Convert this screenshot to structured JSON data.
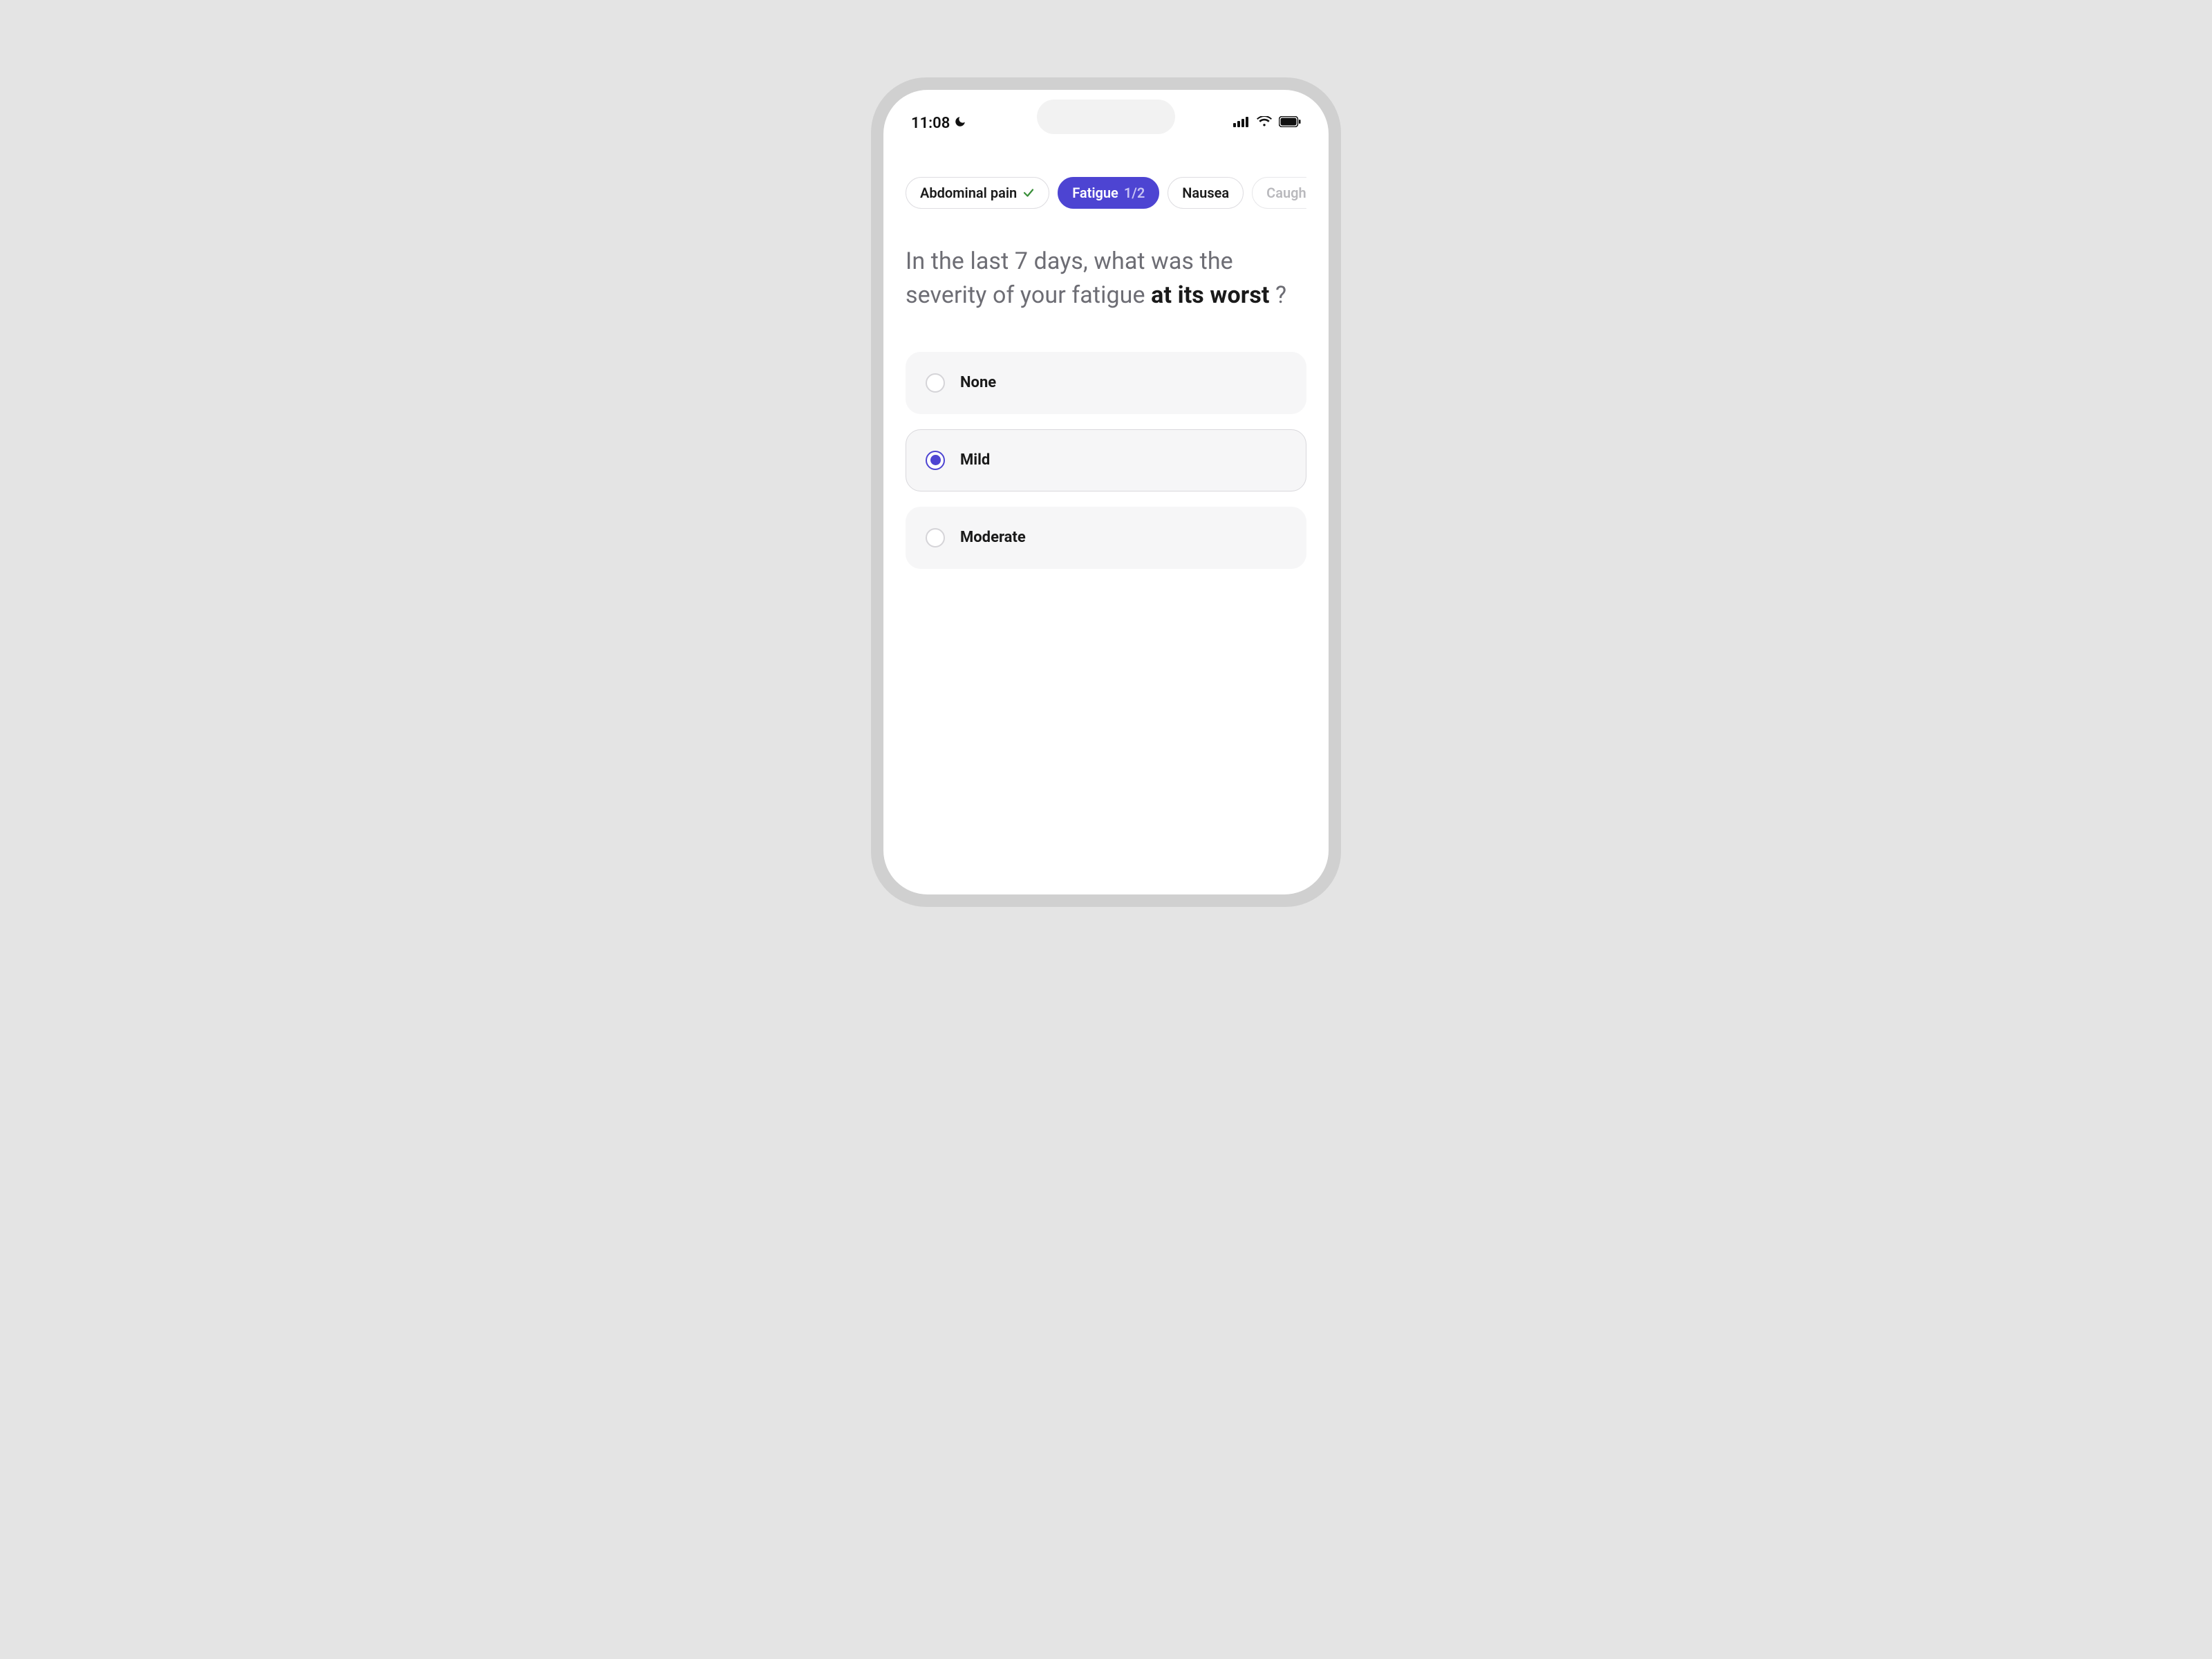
{
  "status": {
    "time": "11:08"
  },
  "chips": [
    {
      "label": "Abdominal pain",
      "completed": true
    },
    {
      "label": "Fatigue",
      "count": "1/2",
      "active": true
    },
    {
      "label": "Nausea"
    },
    {
      "label": "Caugh",
      "faded": true
    }
  ],
  "question": {
    "prefix": "In the last 7 days, what was the severity of your fatigue ",
    "bold": "at its worst",
    "suffix": " ?"
  },
  "options": [
    {
      "label": "None",
      "selected": false
    },
    {
      "label": "Mild",
      "selected": true
    },
    {
      "label": "Moderate",
      "selected": false
    }
  ],
  "colors": {
    "accent": "#4d44d2"
  }
}
